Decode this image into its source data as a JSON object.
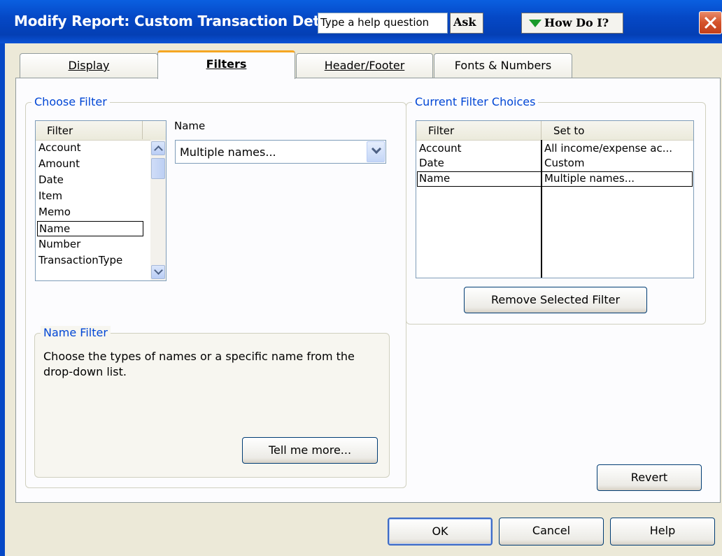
{
  "window": {
    "title": "Modify Report: Custom Transaction Deta",
    "help_placeholder": "Type a help question",
    "ask_label": "Ask",
    "howdoi_label": "How Do I?"
  },
  "tabs": [
    {
      "label": "Display",
      "active": false
    },
    {
      "label": "Filters",
      "active": true
    },
    {
      "label": "Header/Footer",
      "active": false
    },
    {
      "label": "Fonts & Numbers",
      "active": false
    }
  ],
  "choose_filter": {
    "legend": "Choose Filter",
    "list_header": "Filter",
    "items": [
      "Account",
      "Amount",
      "Date",
      "Item",
      "Memo",
      "Name",
      "Number",
      "TransactionType"
    ],
    "selected": "Name",
    "field_label": "Name",
    "field_value": "Multiple names..."
  },
  "name_filter": {
    "legend": "Name Filter",
    "description": "Choose the types of names or a specific name from the drop-down list.",
    "tell_more_label": "Tell me more..."
  },
  "current_filters": {
    "legend": "Current Filter Choices",
    "col_filter": "Filter",
    "col_set_to": "Set to",
    "rows": [
      {
        "filter": "Account",
        "set_to": "All income/expense ac..."
      },
      {
        "filter": "Date",
        "set_to": "Custom"
      },
      {
        "filter": "Name",
        "set_to": "Multiple names..."
      }
    ],
    "selected_row": 2,
    "remove_label": "Remove Selected Filter"
  },
  "buttons": {
    "revert": "Revert",
    "ok": "OK",
    "cancel": "Cancel",
    "help": "Help"
  },
  "colors": {
    "titlebar": "#0548c6",
    "legend": "#0046d5",
    "active_tab_accent": "#f5a623",
    "close_button": "#d4522a"
  }
}
